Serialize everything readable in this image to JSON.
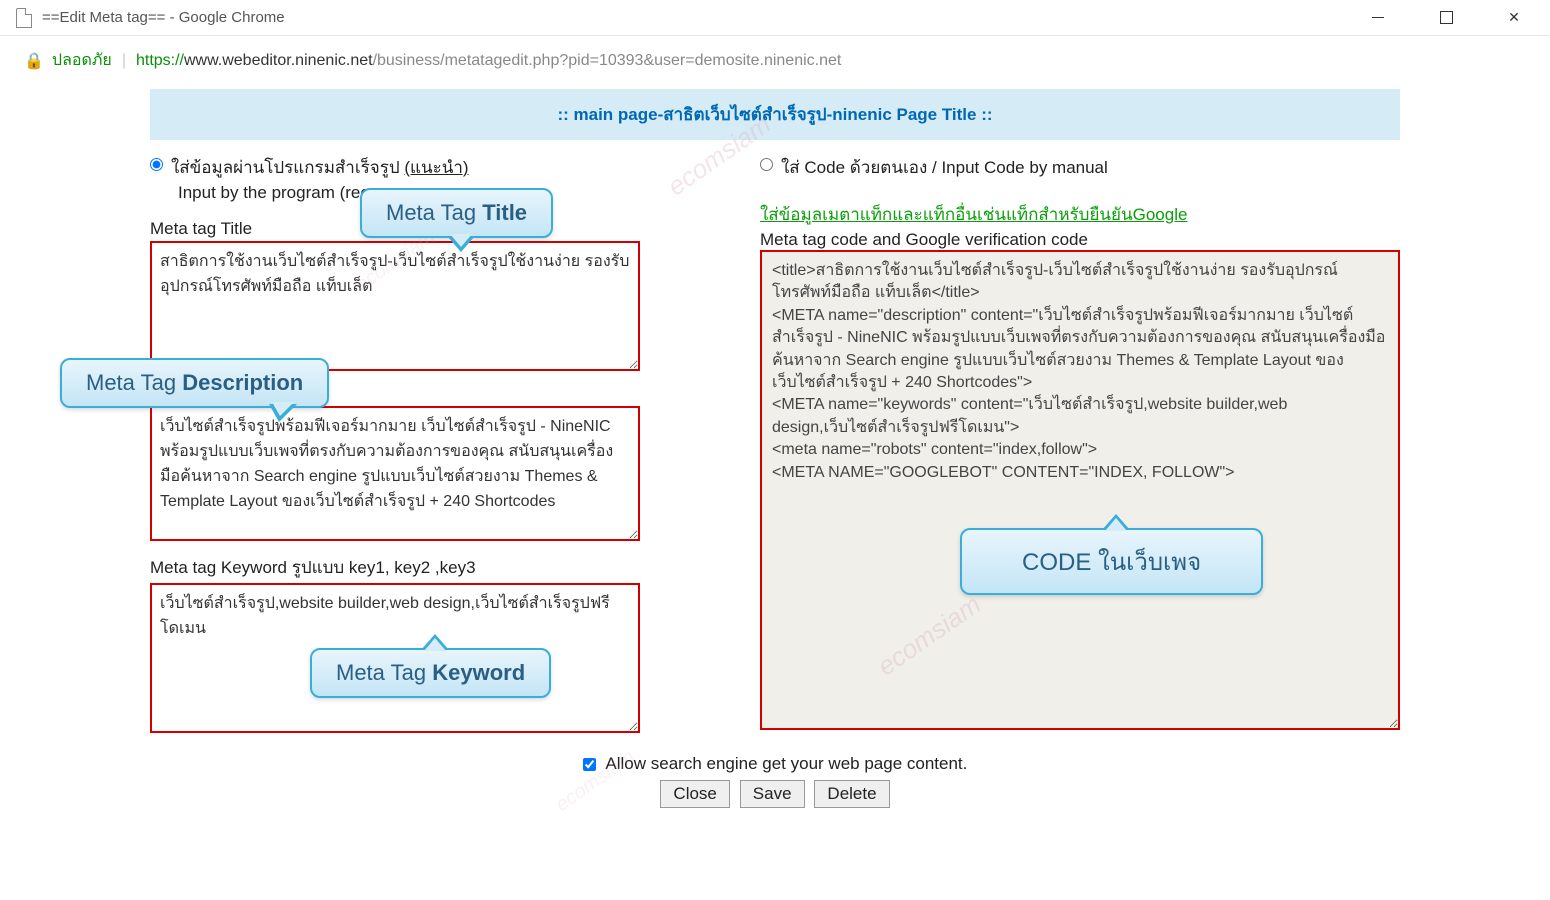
{
  "window": {
    "title": "==Edit Meta tag== - Google Chrome"
  },
  "address": {
    "secure_label": "ปลอดภัย",
    "https": "https://",
    "host": "www.webeditor.ninenic.net",
    "path": "/business/metatagedit.php?pid=10393&user=demosite.ninenic.net"
  },
  "header": ":: main page-สาธิตเว็บไซต์สำเร็จรูป-ninenic Page Title ::",
  "left": {
    "radio_label_thai": "ใส่ข้อมูลผ่านโปรแกรมสำเร็จรูป ",
    "radio_label_recommend": "(แนะนำ)",
    "radio_sub": "Input by the program (recom",
    "title_label": "Meta tag Title",
    "title_value": "สาธิตการใช้งานเว็บไซต์สำเร็จรูป-เว็บไซต์สำเร็จรูปใช้งานง่าย รองรับอุปกรณ์โทรศัพท์มือถือ แท็บเล็ต",
    "desc_label": "Meta tag Description",
    "desc_value": "เว็บไซต์สำเร็จรูปพร้อมฟีเจอร์มากมาย เว็บไซต์สำเร็จรูป - NineNIC พร้อมรูปแบบเว็บเพจที่ตรงกับความต้องการของคุณ สนับสนุนเครื่องมือค้นหาจาก Search engine รูปแบบเว็บไซต์สวยงาม Themes & Template Layout ของเว็บไซต์สำเร็จรูป + 240 Shortcodes",
    "key_label": "Meta tag Keyword รูปแบบ key1, key2 ,key3",
    "key_value": "เว็บไซต์สำเร็จรูป,website builder,web design,เว็บไซต์สำเร็จรูปฟรีโดเมน"
  },
  "right": {
    "radio_label": "ใส่ Code ด้วยตนเอง / Input Code by manual",
    "green_line": "ใส่ข้อมูลเมตาแท็กและแท็กอื่นเช่นแท็กสำหรับยืนยันGoogle",
    "code_label": "Meta tag code and Google verification code",
    "code_value": "<title>สาธิตการใช้งานเว็บไซต์สำเร็จรูป-เว็บไซต์สำเร็จรูปใช้งานง่าย รองรับอุปกรณ์โทรศัพท์มือถือ แท็บเล็ต</title>\n<META name=\"description\" content=\"เว็บไซต์สำเร็จรูปพร้อมฟีเจอร์มากมาย เว็บไซต์สำเร็จรูป - NineNIC พร้อมรูปแบบเว็บเพจที่ตรงกับความต้องการของคุณ สนับสนุนเครื่องมือค้นหาจาก Search engine รูปแบบเว็บไซต์สวยงาม Themes & Template Layout ของเว็บไซต์สำเร็จรูป + 240 Shortcodes\">\n<META name=\"keywords\" content=\"เว็บไซต์สำเร็จรูป,website builder,web design,เว็บไซต์สำเร็จรูปฟรีโดเมน\">\n<meta name=\"robots\" content=\"index,follow\">\n<META NAME=\"GOOGLEBOT\" CONTENT=\"INDEX, FOLLOW\">"
  },
  "callouts": {
    "title_pre": "Meta Tag ",
    "title_bold": "Title",
    "desc_pre": "Meta Tag  ",
    "desc_bold": "Description",
    "key_pre": "Meta Tag  ",
    "key_bold": "Keyword",
    "code_pre": "CODE  ",
    "code_rest": "ในเว็บเพจ"
  },
  "footer": {
    "allow": "Allow search engine get your web page content.",
    "close": "Close",
    "save": "Save",
    "delete": "Delete"
  },
  "watermark": "ecomsiam"
}
